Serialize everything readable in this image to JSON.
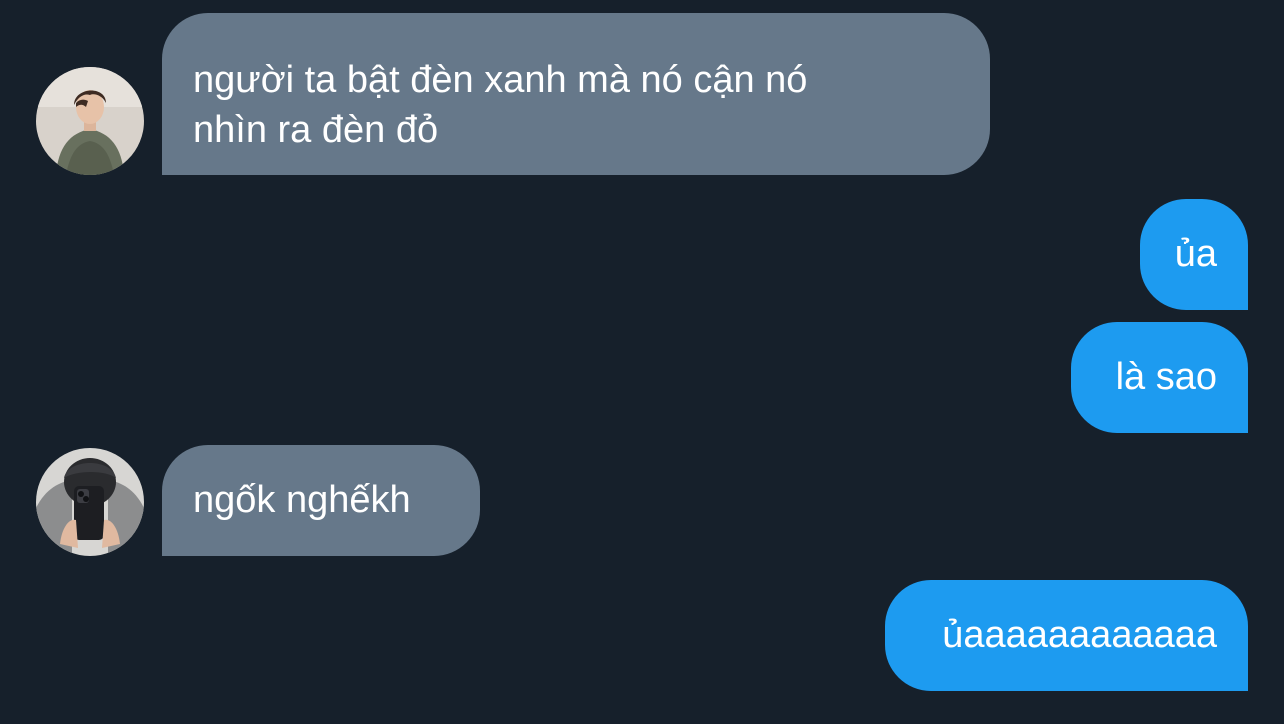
{
  "conversation": {
    "messages": [
      {
        "side": "incoming",
        "avatar": "person-photo-avatar",
        "lines": [
          "người ta bật đèn xanh mà nó cận nó",
          "nhìn ra đèn đỏ"
        ]
      },
      {
        "side": "outgoing",
        "text": "ủa"
      },
      {
        "side": "outgoing",
        "text": "là sao"
      },
      {
        "side": "incoming",
        "avatar": "mirror-selfie-avatar",
        "text": "ngốk nghếkh"
      },
      {
        "side": "outgoing",
        "text": "ủaaaaaaaaaaaa"
      }
    ]
  },
  "colors": {
    "background": "#16202b",
    "incoming_bubble": "#66788a",
    "outgoing_bubble": "#1d9bf0",
    "text": "#ffffff"
  }
}
